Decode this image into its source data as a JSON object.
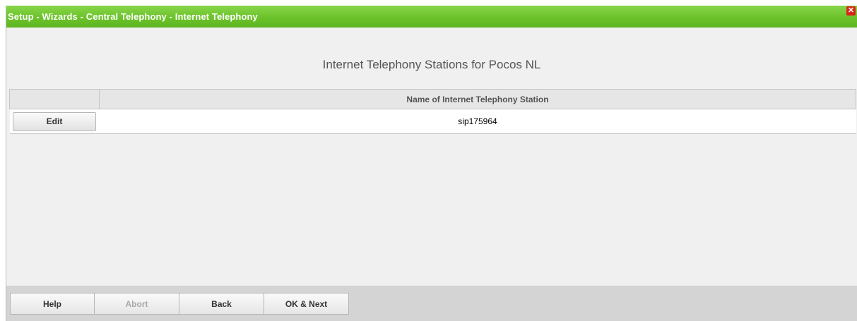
{
  "window": {
    "title": "Setup - Wizards - Central Telephony - Internet Telephony",
    "close_symbol": "✕"
  },
  "page": {
    "heading": "Internet Telephony Stations for Pocos NL"
  },
  "table": {
    "columns": [
      "",
      "Name of Internet Telephony Station"
    ],
    "rows": [
      {
        "action": "Edit",
        "name": "sip175964"
      }
    ]
  },
  "footer": {
    "buttons": [
      {
        "label": "Help",
        "enabled": true
      },
      {
        "label": "Abort",
        "enabled": false
      },
      {
        "label": "Back",
        "enabled": true
      },
      {
        "label": "OK & Next",
        "enabled": true
      }
    ]
  },
  "colors": {
    "titlebar": "#6cc22a",
    "close": "#d9221a",
    "background": "#f0f0f0",
    "footer": "#d4d4d4"
  },
  "icons": {
    "close": "close-icon"
  }
}
